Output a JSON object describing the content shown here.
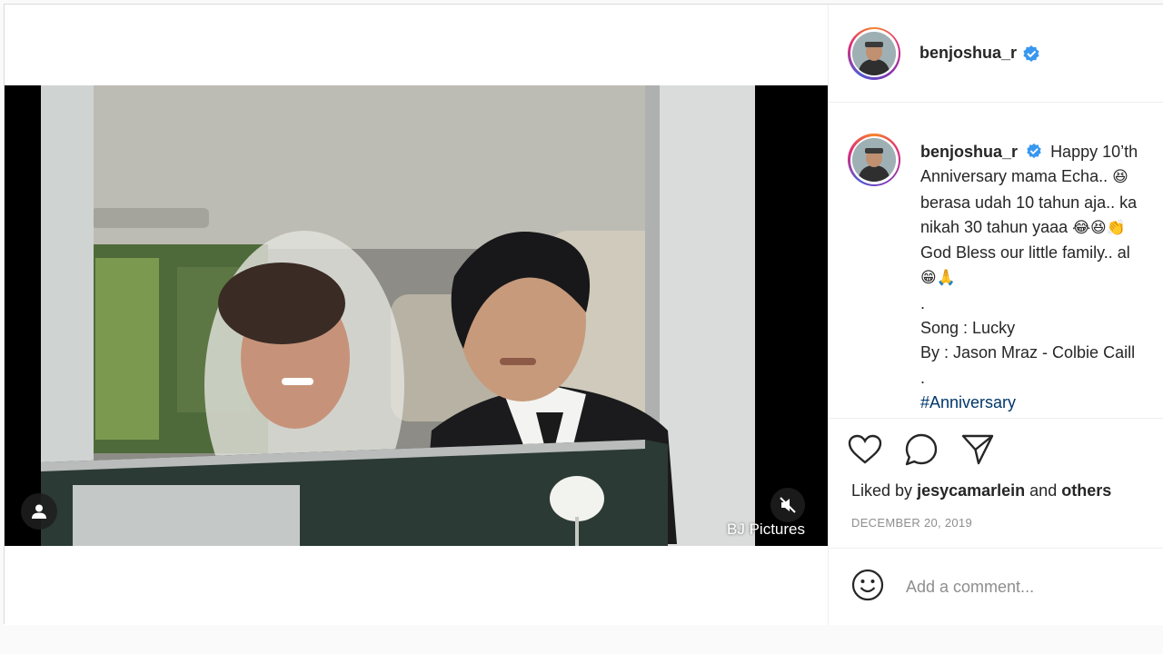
{
  "post": {
    "username": "benjoshua_r",
    "verified": true,
    "watermark": "BJ Pictures",
    "caption": {
      "username": "benjoshua_r",
      "lines": [
        "Happy 10’th",
        "Anniversary mama Echa..",
        "berasa udah 10 tahun aja.. ka",
        "nikah 30 tahun yaaa",
        "God Bless our little family.. al",
        "",
        ".",
        "Song : Lucky",
        "By : Jason Mraz - Colbie Caill",
        "."
      ],
      "emojis": {
        "line2": "😆",
        "line4": "😂😆👏",
        "line6": "😁🙏"
      },
      "hashtag": "#Anniversary"
    },
    "liked_by": {
      "prefix": "Liked by",
      "user": "jesycamarlein",
      "middle": "and",
      "others": "others"
    },
    "date": "DECEMBER 20, 2019",
    "comment_placeholder": "Add a comment...",
    "icons": {
      "like": "heart-icon",
      "comment": "comment-icon",
      "share": "share-icon",
      "emoji": "emoji-icon",
      "mute": "muted-speaker-icon",
      "user_tag": "user-icon",
      "verified": "verified-badge-icon"
    },
    "colors": {
      "verified": "#3897f0",
      "hashtag": "#00376b",
      "muted_text": "#8e8e8e"
    }
  }
}
